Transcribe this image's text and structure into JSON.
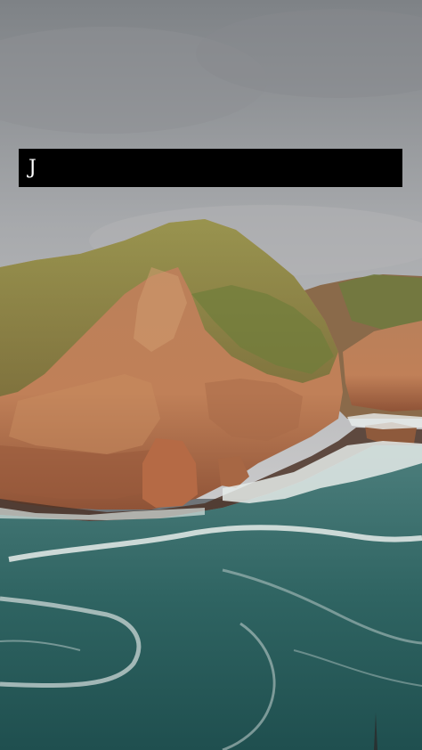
{
  "caption": {
    "text": "J"
  },
  "scene": {
    "description_tags": [
      "sky-icon",
      "cliff-icon",
      "sea-icon"
    ],
    "colors": {
      "sky_top": "#8b8e92",
      "sky_bottom": "#c5c6c8",
      "cliff_rock": "#b7764f",
      "cliff_shadow": "#8a4f33",
      "vegetation": "#7d8a3e",
      "sea_deep": "#2b5d5c",
      "sea_light": "#4a7d7b",
      "foam": "#e6ecea",
      "caption_bg": "#000000",
      "caption_fg": "#ffffff"
    }
  }
}
